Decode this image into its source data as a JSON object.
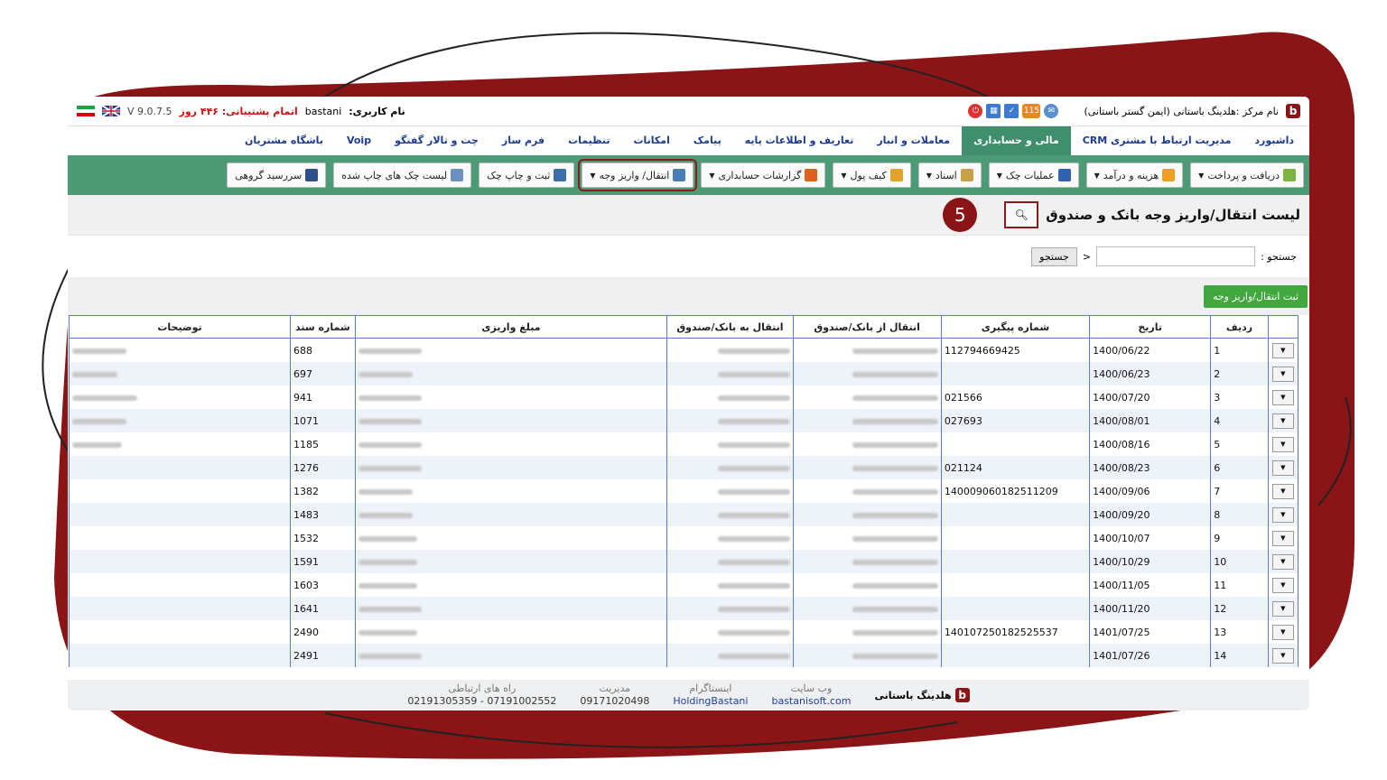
{
  "header": {
    "center_name": "نام مرکز :هلدینگ باستانی (ایمن گستر باستانی)",
    "notif_count": "115",
    "username_label": "نام کاربری:",
    "username": "bastani",
    "support_label": "اتمام پشتیبانی: ۴۴۶ روز",
    "version": "V 9.0.7.5"
  },
  "menu": [
    {
      "label": "داشبورد",
      "active": false
    },
    {
      "label": "مدیریت ارتباط با مشتری CRM",
      "active": false
    },
    {
      "label": "مالی و حسابداری",
      "active": true
    },
    {
      "label": "معاملات و انبار",
      "active": false
    },
    {
      "label": "تعاریف و اطلاعات پایه",
      "active": false
    },
    {
      "label": "پیامک",
      "active": false
    },
    {
      "label": "امکانات",
      "active": false
    },
    {
      "label": "تنظیمات",
      "active": false
    },
    {
      "label": "فرم ساز",
      "active": false
    },
    {
      "label": "چت و تالار گفتگو",
      "active": false
    },
    {
      "label": "Voip",
      "active": false
    },
    {
      "label": "باشگاه مشتریان",
      "active": false
    }
  ],
  "toolbar": [
    {
      "label": "دریافت و پرداخت",
      "dropdown": true,
      "icon": "money-icon",
      "color": "#7cb342"
    },
    {
      "label": "هزینه و درآمد",
      "dropdown": true,
      "icon": "coins-icon",
      "color": "#f0a020"
    },
    {
      "label": "عملیات چک",
      "dropdown": true,
      "icon": "check-pen-icon",
      "color": "#2f62b0"
    },
    {
      "label": "اسناد",
      "dropdown": true,
      "icon": "document-icon",
      "color": "#c9a04a"
    },
    {
      "label": "کیف پول",
      "dropdown": true,
      "icon": "wallet-icon",
      "color": "#e2a32a"
    },
    {
      "label": "گزارشات حسابداری",
      "dropdown": true,
      "icon": "report-icon",
      "color": "#e06020"
    },
    {
      "label": "انتقال/ واریز وجه",
      "dropdown": true,
      "icon": "transfer-icon",
      "color": "#4a7fb5",
      "highlight": true
    },
    {
      "label": "ثبت و چاپ چک",
      "dropdown": false,
      "icon": "print-check-icon",
      "color": "#3b6ea8"
    },
    {
      "label": "لیست چک های چاپ شده",
      "dropdown": false,
      "icon": "list-icon",
      "color": "#6a8fc0"
    },
    {
      "label": "سررسید گروهی",
      "dropdown": false,
      "icon": "calendar-icon",
      "color": "#2d4f8a"
    }
  ],
  "page": {
    "title": "لیست انتقال/واریز وجه بانک و صندوق",
    "step": "5",
    "search_label": "جستجو :",
    "search_button": "جستجو",
    "add_button": "ثبت انتقال/واریز وجه"
  },
  "table": {
    "headers": [
      "ردیف",
      "تاریخ",
      "شماره پیگیری",
      "انتقال از بانک/صندوق",
      "انتقال به بانک/صندوق",
      "مبلغ واریزی",
      "شماره سند",
      "توضیحات"
    ],
    "rows": [
      {
        "row": "1",
        "date": "1400/06/22",
        "tracking": "112794669425",
        "doc": "688"
      },
      {
        "row": "2",
        "date": "1400/06/23",
        "tracking": "",
        "doc": "697"
      },
      {
        "row": "3",
        "date": "1400/07/20",
        "tracking": "021566",
        "doc": "941"
      },
      {
        "row": "4",
        "date": "1400/08/01",
        "tracking": "027693",
        "doc": "1071"
      },
      {
        "row": "5",
        "date": "1400/08/16",
        "tracking": "",
        "doc": "1185"
      },
      {
        "row": "6",
        "date": "1400/08/23",
        "tracking": "021124",
        "doc": "1276"
      },
      {
        "row": "7",
        "date": "1400/09/06",
        "tracking": "140009060182511209",
        "doc": "1382"
      },
      {
        "row": "8",
        "date": "1400/09/20",
        "tracking": "",
        "doc": "1483"
      },
      {
        "row": "9",
        "date": "1400/10/07",
        "tracking": "",
        "doc": "1532"
      },
      {
        "row": "10",
        "date": "1400/10/29",
        "tracking": "",
        "doc": "1591"
      },
      {
        "row": "11",
        "date": "1400/11/05",
        "tracking": "",
        "doc": "1603"
      },
      {
        "row": "12",
        "date": "1400/11/20",
        "tracking": "",
        "doc": "1641"
      },
      {
        "row": "13",
        "date": "1401/07/25",
        "tracking": "140107250182525537",
        "doc": "2490"
      },
      {
        "row": "14",
        "date": "1401/07/26",
        "tracking": "",
        "doc": "2491"
      }
    ]
  },
  "footer": {
    "brand": "هلدینگ باستانی",
    "website_label": "وب سایت",
    "website": "bastanisoft.com",
    "instagram_label": "اینستاگرام",
    "instagram": "HoldingBastani",
    "management_label": "مدیریت",
    "management_phone": "09171020498",
    "contact_label": "راه های ارتباطی",
    "contact_phones": "07191002552 - 02191305359"
  },
  "colors": {
    "accent_red": "#8b1417",
    "toolbar_green": "#4d9a77",
    "add_green": "#41a83f",
    "link_blue": "#1b3b8f"
  }
}
